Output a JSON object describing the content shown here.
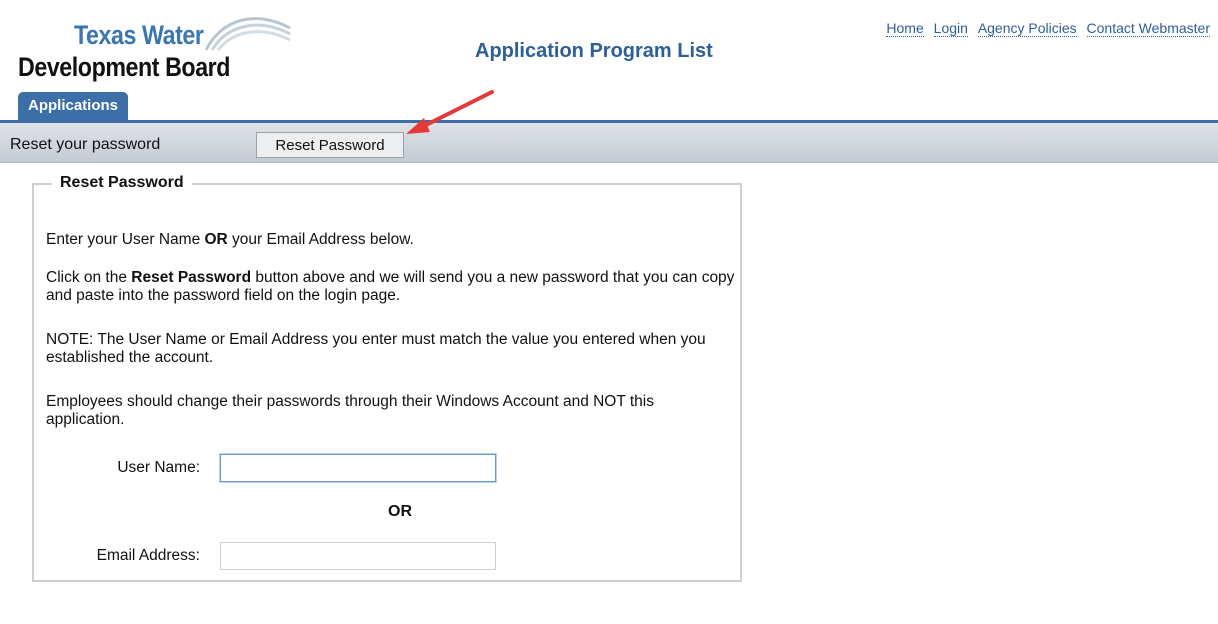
{
  "logo": {
    "line1": "Texas Water",
    "line2": "Development Board"
  },
  "page_title": "Application Program List",
  "top_links": [
    "Home",
    "Login",
    "Agency Policies",
    "Contact Webmaster"
  ],
  "tab": {
    "label": "Applications"
  },
  "toolbar": {
    "text": "Reset your password",
    "reset_button_label": "Reset Password"
  },
  "panel": {
    "legend": "Reset Password",
    "para1": {
      "pre": "Enter your User Name ",
      "bold": "OR",
      "post": " your Email Address below."
    },
    "para2": {
      "pre": "Click on the ",
      "bold": "Reset Password",
      "post": " button above and we will send you a new password that you can copy and paste into the password field on the login page."
    },
    "para3": "NOTE: The User Name or Email Address you enter must match the value you entered when you established the account.",
    "para4": "Employees should change their passwords through their Windows Account and NOT this application.",
    "username_label": "User Name:",
    "username_value": "",
    "or_text": "OR",
    "email_label": "Email Address:",
    "email_value": ""
  },
  "colors": {
    "accent": "#3c6ea8",
    "title": "#2c5f9a",
    "arrow": "#e53935"
  }
}
